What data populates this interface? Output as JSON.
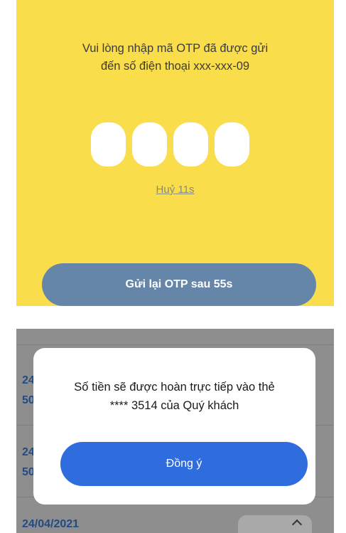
{
  "otp_screen": {
    "message": "Vui lòng nhập mã OTP đã được gửi\nđến số điện thoại xxx-xxx-09",
    "otp_digits": [
      "",
      "",
      "",
      ""
    ],
    "cancel_label": "Huỷ 11s",
    "resend_label": "Gửi lại OTP sau 55s"
  },
  "list_screen": {
    "rows": [
      {
        "date_fragment": "24",
        "amount_fragment": "50"
      },
      {
        "date_fragment": "24",
        "amount_fragment": "50"
      }
    ],
    "last_date": "24/04/2021"
  },
  "dialog": {
    "message": "Số tiền sẽ được hoàn trực tiếp vào thẻ\n**** 3514 của Quý khách",
    "confirm_label": "Đồng ý"
  }
}
